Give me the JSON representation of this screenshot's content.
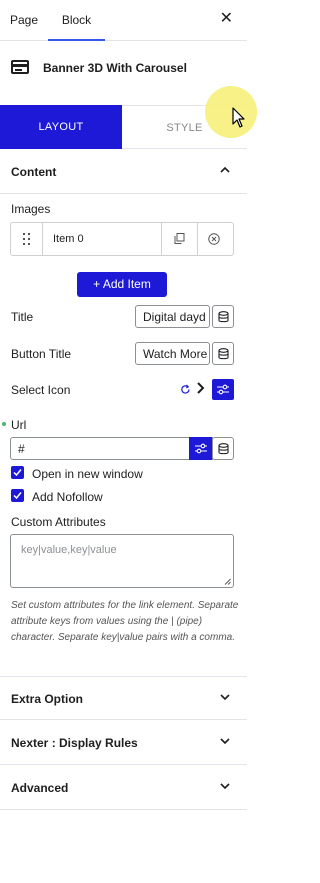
{
  "tabs": {
    "page": "Page",
    "block": "Block"
  },
  "block_card": {
    "title": "Banner 3D With Carousel"
  },
  "mode_tabs": {
    "layout": "LAYOUT",
    "style": "STYLE"
  },
  "content": {
    "heading": "Content",
    "images_label": "Images",
    "repeater_item": "Item 0",
    "add_item": "+ Add Item",
    "title_label": "Title",
    "title_value": "Digital dayd",
    "button_title_label": "Button Title",
    "button_title_value": "Watch More",
    "select_icon_label": "Select Icon",
    "url_label": "Url",
    "url_value": "#",
    "open_new_window": "Open in new window",
    "add_nofollow": "Add Nofollow",
    "custom_attributes_label": "Custom Attributes",
    "custom_attributes_placeholder": "key|value,key|value",
    "help_text": "Set custom attributes for the link element. Separate attribute keys from values using the | (pipe) character. Separate key|value pairs with a comma."
  },
  "sections": {
    "extra_option": "Extra Option",
    "display_rules": "Nexter : Display Rules",
    "advanced": "Advanced"
  },
  "colors": {
    "accent": "#1d19d6",
    "tab_indicator": "#3858e9",
    "cursor_highlight": "#f6f07a"
  }
}
